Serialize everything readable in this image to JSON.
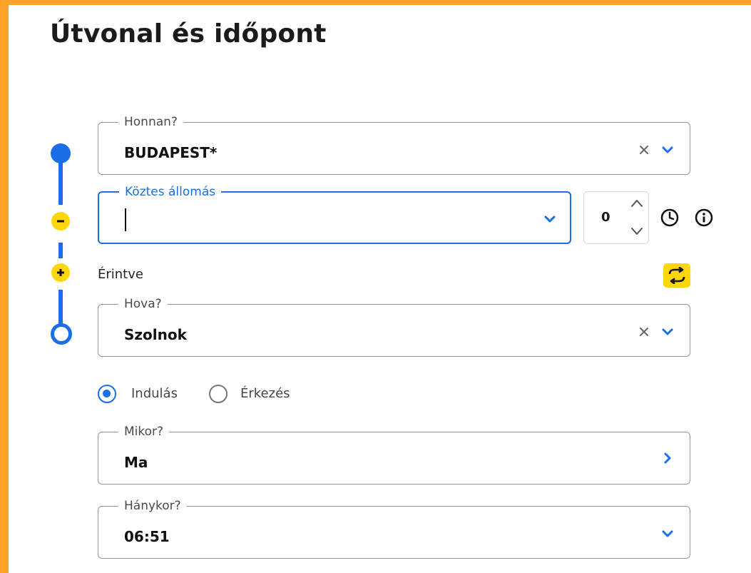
{
  "page": {
    "title": "Útvonal és időpont"
  },
  "from": {
    "legend": "Honnan?",
    "value": "BUDAPEST*"
  },
  "via": {
    "legend": "Köztes állomás",
    "value": "",
    "wait_minutes": "0"
  },
  "via_mode_label": "Érintve",
  "to": {
    "legend": "Hova?",
    "value": "Szolnok"
  },
  "direction": {
    "options": [
      {
        "label": "Indulás",
        "selected": true
      },
      {
        "label": "Érkezés",
        "selected": false
      }
    ]
  },
  "date": {
    "legend": "Mikor?",
    "value": "Ma"
  },
  "time": {
    "legend": "Hánykor?",
    "value": "06:51"
  },
  "colors": {
    "accent": "#1a6ee8",
    "frame": "#ffa22a",
    "yellow": "#ffd60a"
  }
}
